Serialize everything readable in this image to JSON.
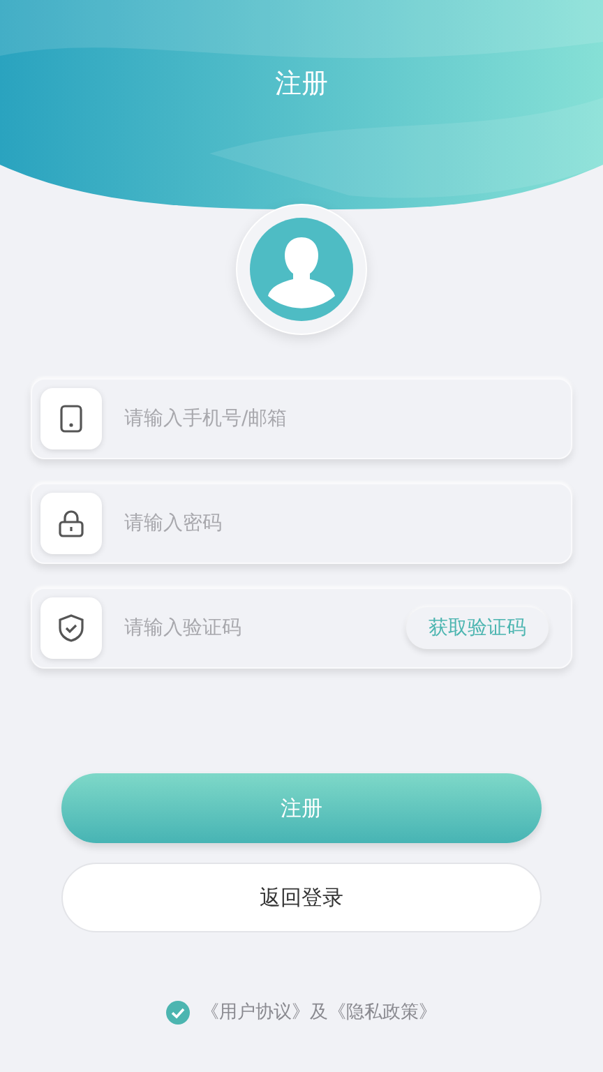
{
  "title": "注册",
  "fields": [
    {
      "kind": "phone",
      "placeholder": "请输入手机号/邮箱"
    },
    {
      "kind": "password",
      "placeholder": "请输入密码"
    },
    {
      "kind": "code",
      "placeholder": "请输入验证码",
      "action": "获取验证码"
    }
  ],
  "primary_button": "注册",
  "secondary_button": "返回登录",
  "agreement": {
    "checked": true,
    "text": "《用户协议》及《隐私政策》"
  }
}
